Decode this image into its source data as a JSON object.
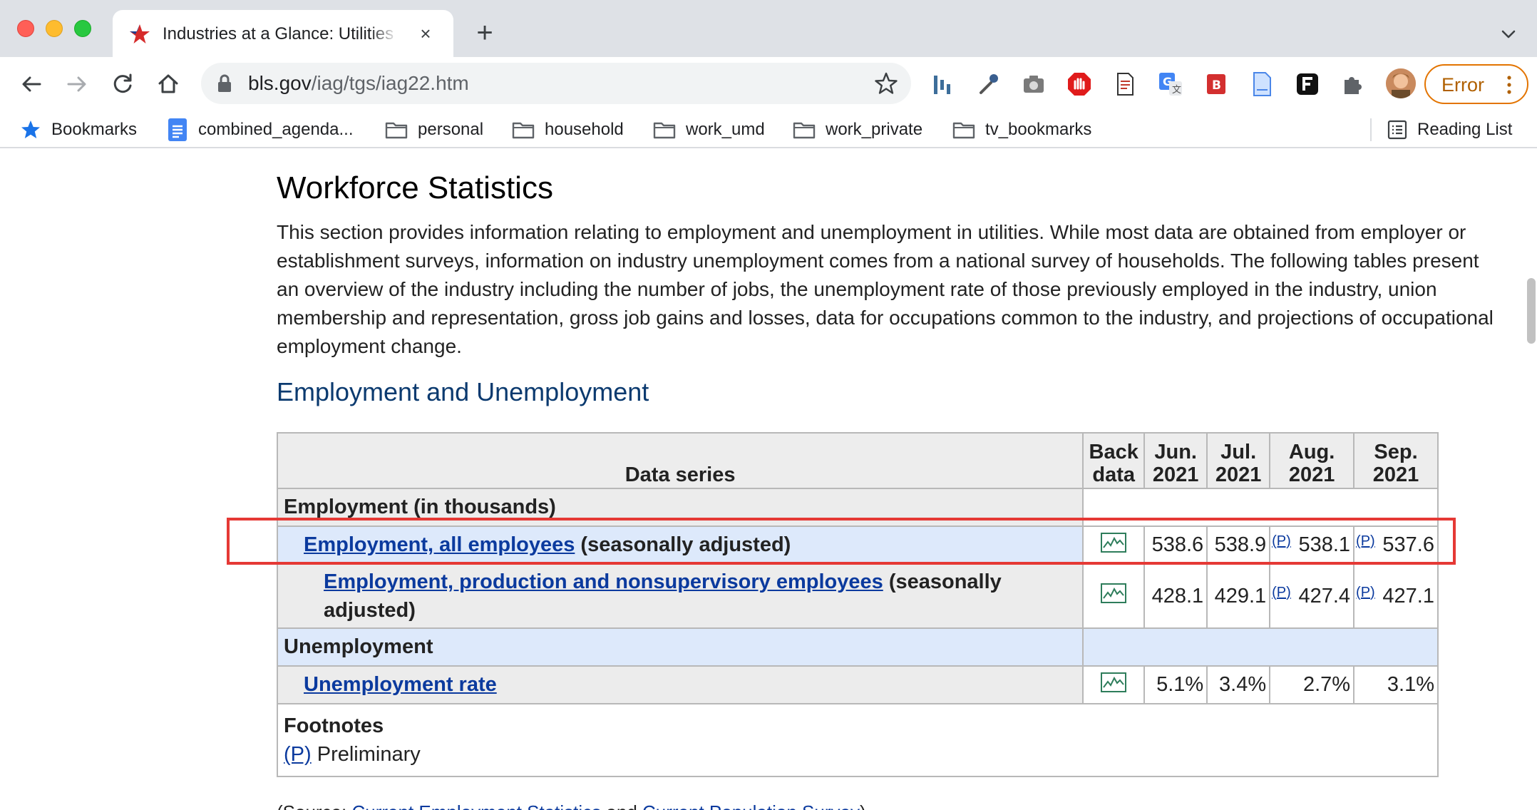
{
  "browser": {
    "tab_title": "Industries at a Glance: Utilities",
    "tab_close": "×",
    "new_tab": "+",
    "url_host": "bls.gov",
    "url_path": "/iag/tgs/iag22.htm",
    "profile_button": "Error",
    "bookmarks": [
      {
        "label": "Bookmarks",
        "icon": "star-icon"
      },
      {
        "label": "combined_agenda...",
        "icon": "docs-icon"
      },
      {
        "label": "personal",
        "icon": "folder-icon"
      },
      {
        "label": "household",
        "icon": "folder-icon"
      },
      {
        "label": "work_umd",
        "icon": "folder-icon"
      },
      {
        "label": "work_private",
        "icon": "folder-icon"
      },
      {
        "label": "tv_bookmarks",
        "icon": "folder-icon"
      }
    ],
    "reading_list": "Reading List",
    "colors": {
      "chrome": "#dee1e6",
      "omnibox": "#f1f3f4",
      "error_accent": "#e37400"
    }
  },
  "page": {
    "heading": "Workforce Statistics",
    "intro": "This section provides information relating to employment and unemployment in utilities. While most data are obtained from employer or establishment surveys, information on industry unemployment comes from a national survey of households. The following tables present an overview of the industry including the number of jobs, the unemployment rate of those previously employed in the industry, union membership and representation, gross job gains and losses, data for occupations common to the industry, and projections of occupational employment change.",
    "section_title": "Employment and Unemployment",
    "table": {
      "headers": {
        "series": "Data series",
        "back_top": "Back",
        "back_bottom": "data",
        "months": [
          {
            "m": "Jun.",
            "y": "2021"
          },
          {
            "m": "Jul.",
            "y": "2021"
          },
          {
            "m": "Aug.",
            "y": "2021"
          },
          {
            "m": "Sep.",
            "y": "2021"
          }
        ]
      },
      "section_employment": "Employment (in thousands)",
      "section_unemployment": "Unemployment",
      "rows": [
        {
          "link": "Employment, all employees",
          "suffix": " (seasonally adjusted)",
          "values": [
            "538.6",
            "538.9",
            "538.1",
            "537.6"
          ],
          "prelim": [
            "",
            "",
            "(P)",
            "(P)"
          ]
        },
        {
          "link": "Employment, production and nonsupervisory employees",
          "suffix": " (seasonally adjusted)",
          "values": [
            "428.1",
            "429.1",
            "427.4",
            "427.1"
          ],
          "prelim": [
            "",
            "",
            "(P)",
            "(P)"
          ]
        },
        {
          "link": "Unemployment rate",
          "suffix": "",
          "values": [
            "5.1%",
            "3.4%",
            "2.7%",
            "3.1%"
          ],
          "prelim": [
            "",
            "",
            "",
            ""
          ]
        }
      ],
      "footnotes_title": "Footnotes",
      "footnote_marker": "(P)",
      "footnote_text": " Preliminary"
    },
    "source_prefix": "(Source: ",
    "source_link1": "Current Employment Statistics",
    "source_mid": " and ",
    "source_link2": "Current Population Survey",
    "source_suffix": ")",
    "colors": {
      "link": "#0b3a9e",
      "heading_blue": "#0b3a6f",
      "highlight_row": "#dde9fb",
      "annotation": "#e53935"
    }
  }
}
